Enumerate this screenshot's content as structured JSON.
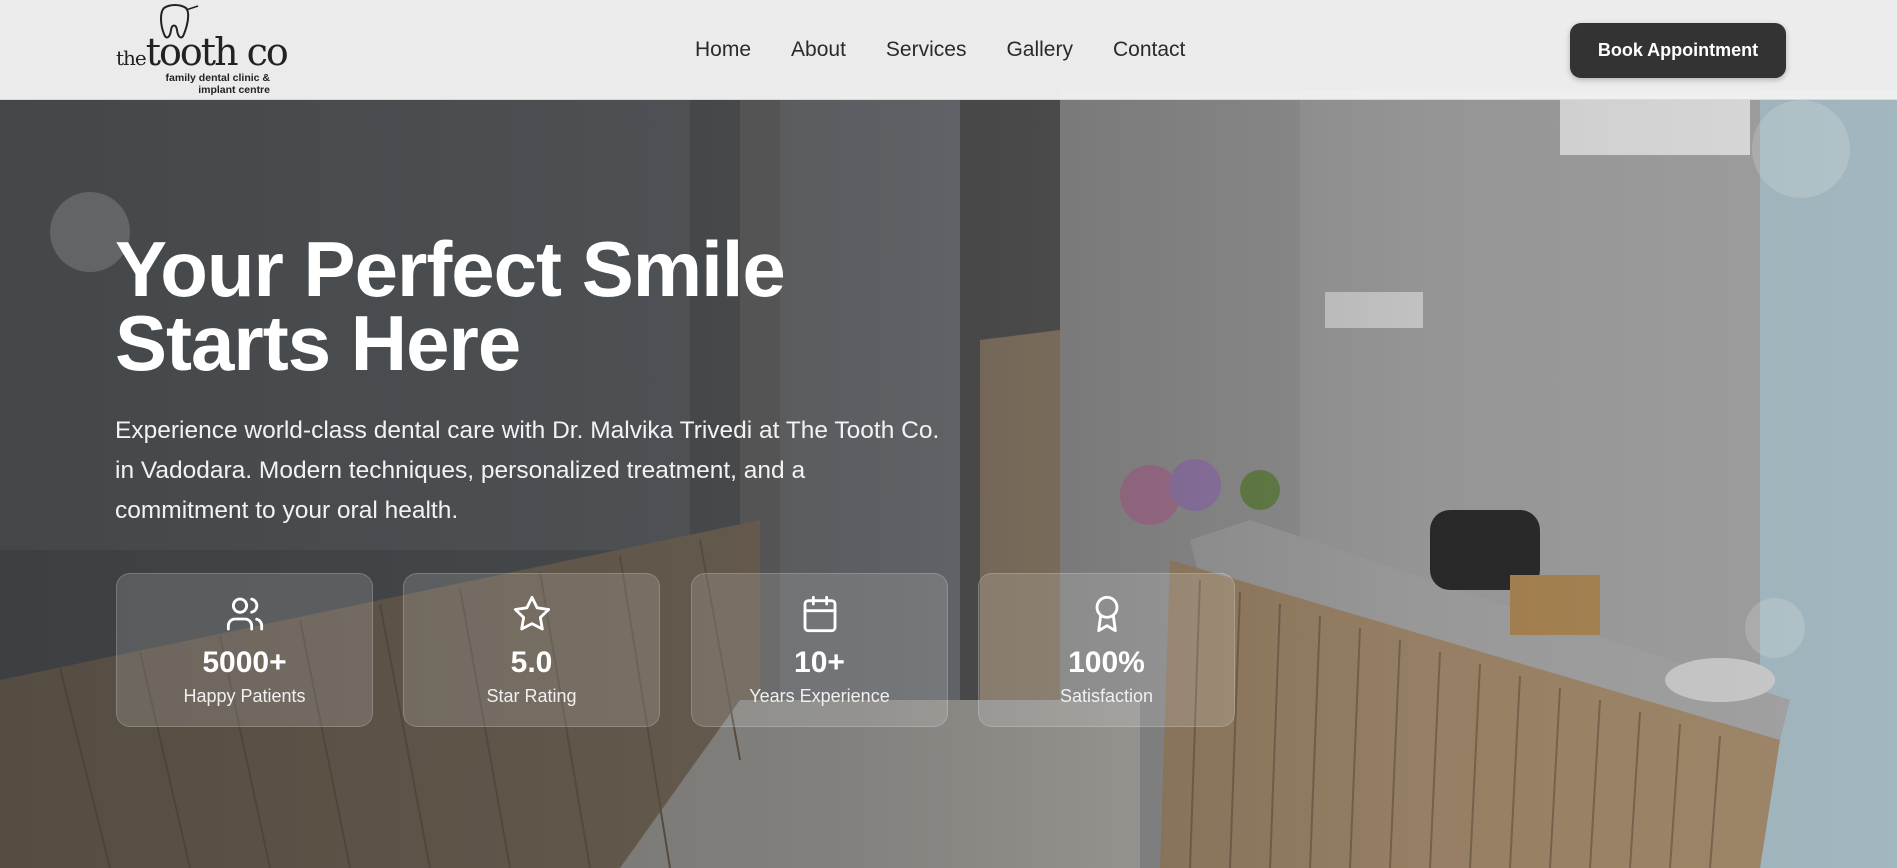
{
  "brand": {
    "logo_the": "the",
    "logo_name": "tooth co",
    "logo_sub_line1": "family dental clinic &",
    "logo_sub_line2": "implant centre"
  },
  "nav": {
    "items": [
      "Home",
      "About",
      "Services",
      "Gallery",
      "Contact"
    ]
  },
  "header": {
    "cta_label": "Book Appointment"
  },
  "hero": {
    "title_line1": "Your Perfect Smile",
    "title_line2": "Starts Here",
    "description": "Experience world-class dental care with Dr. Malvika Trivedi at The Tooth Co. in Vadodara. Modern techniques, personalized treatment, and a commitment to your oral health."
  },
  "stats": [
    {
      "icon": "users-icon",
      "value": "5000+",
      "label": "Happy Patients"
    },
    {
      "icon": "star-icon",
      "value": "5.0",
      "label": "Star Rating"
    },
    {
      "icon": "calendar-icon",
      "value": "10+",
      "label": "Years Experience"
    },
    {
      "icon": "award-icon",
      "value": "100%",
      "label": "Satisfaction"
    }
  ],
  "colors": {
    "header_bg": "#f1f1f1",
    "cta_bg": "#333333",
    "text_dark": "#2a2a2a",
    "hero_text": "#ffffff"
  }
}
